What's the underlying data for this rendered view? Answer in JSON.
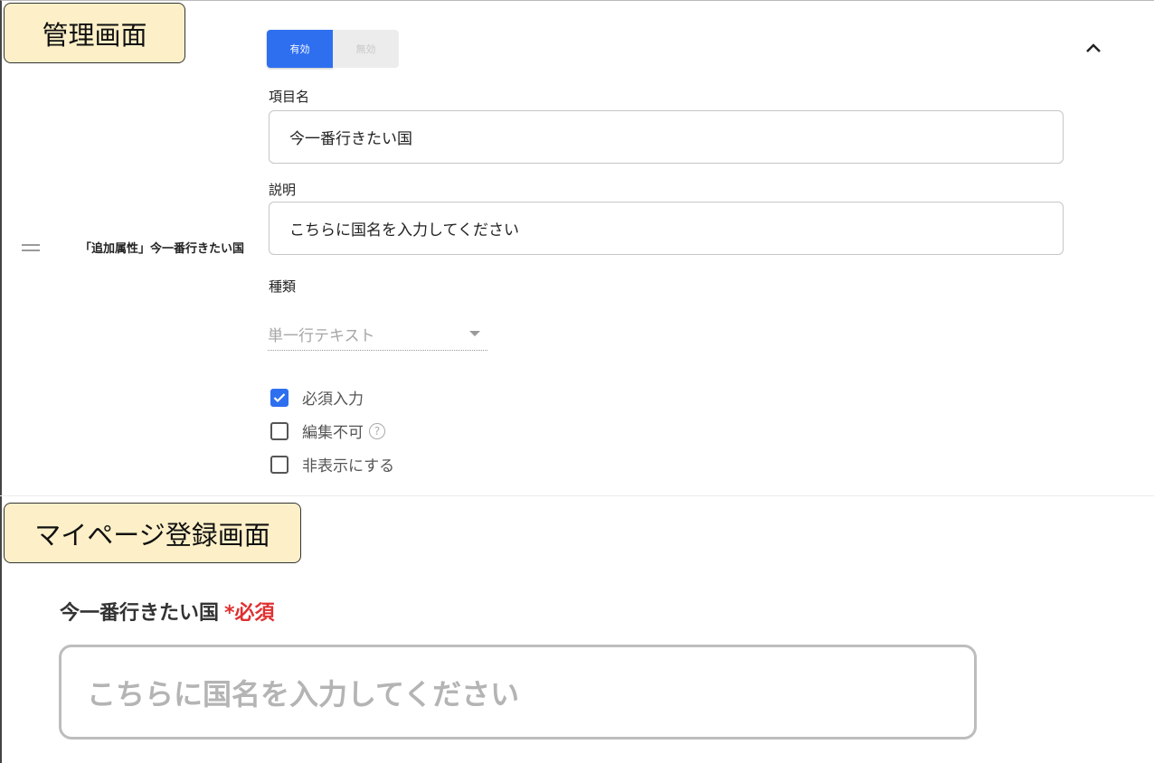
{
  "tags": {
    "admin": "管理画面",
    "mypage": "マイページ登録画面"
  },
  "admin": {
    "toggle": {
      "on_label": "有効",
      "off_label": "無効"
    },
    "item_title": "「追加属性」今一番行きたい国",
    "name_label": "項目名",
    "name_value": "今一番行きたい国",
    "desc_label": "説明",
    "desc_value": "こちらに国名を入力してください",
    "type_label": "種類",
    "type_value": "単一行テキスト",
    "checks": [
      {
        "label": "必須入力",
        "checked": true
      },
      {
        "label": "編集不可",
        "checked": false
      },
      {
        "label": "非表示にする",
        "checked": false
      }
    ]
  },
  "mypage": {
    "field_label": "今一番行きたい国",
    "required": "*必須",
    "placeholder": "こちらに国名を入力してください"
  },
  "colors": {
    "accent": "#2e6ff0",
    "required": "#e03030",
    "tag_bg": "#fdf0c8"
  }
}
